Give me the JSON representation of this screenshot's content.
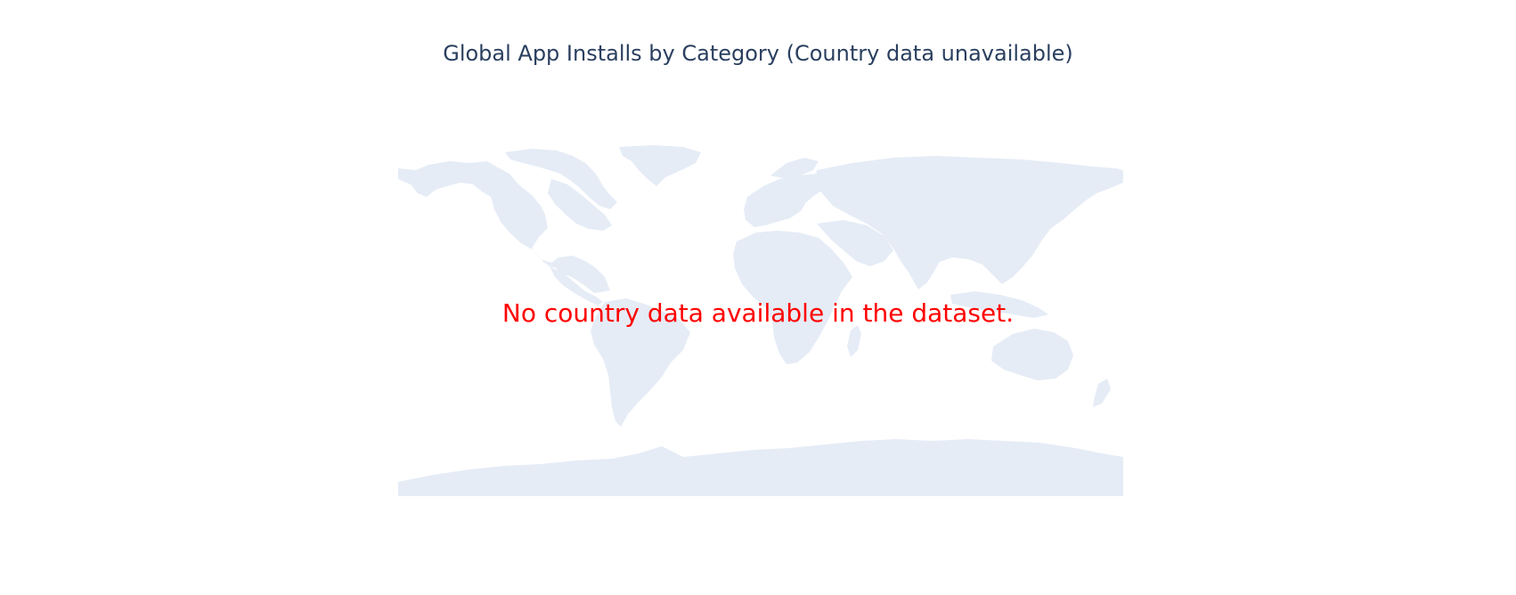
{
  "title": "Global App Installs by Category (Country data unavailable)",
  "annotation": {
    "text": "No country data available in the dataset.",
    "color": "#ff0000"
  },
  "map": {
    "projection": "equirectangular",
    "land_color": "#e5ecf6",
    "background_color": "#ffffff",
    "countries_with_data": []
  },
  "colors": {
    "title": "#2a3f5f",
    "land": "#e5ecf6"
  }
}
